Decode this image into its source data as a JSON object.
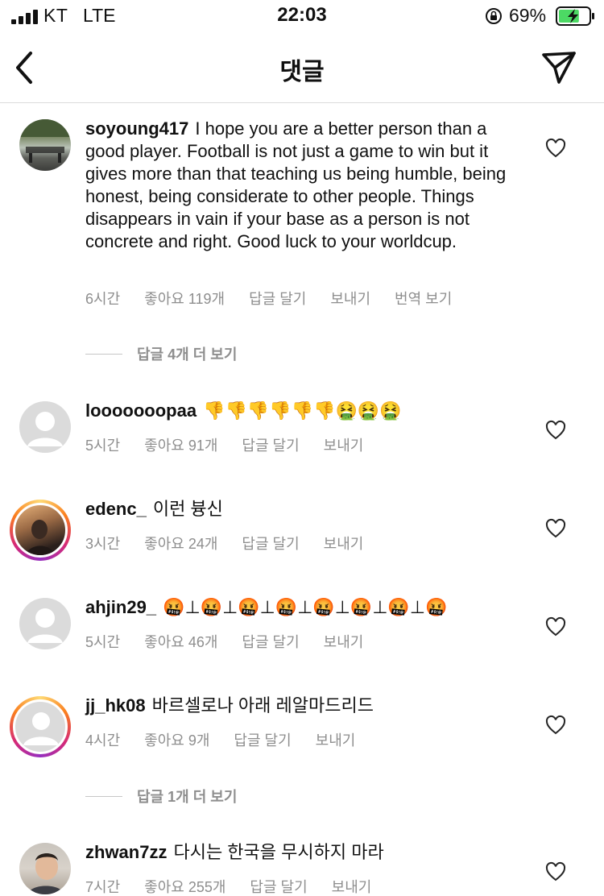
{
  "status_bar": {
    "carrier": "KT",
    "network": "LTE",
    "time": "22:03",
    "battery_percent": "69%",
    "battery_level": 0.69
  },
  "header": {
    "title": "댓글",
    "back_icon": "chevron-left-icon",
    "share_icon": "paper-plane-icon"
  },
  "comments": [
    {
      "username": "soyoung417",
      "text": "I hope you are a better person than a good player. Football is not just a game to win but it gives more than that teaching us being humble, being honest, being considerate to other people. Things disappears in vain if your base as a person is not concrete and right. Good luck to your worldcup.",
      "time": "6시간",
      "likes": "좋아요 119개",
      "reply": "답글 달기",
      "send": "보내기",
      "translate": "번역 보기",
      "view_replies": "답글 4개 더 보기"
    },
    {
      "username": "looooooopaa",
      "text": "👎👎👎👎👎👎🤮🤮🤮",
      "time": "5시간",
      "likes": "좋아요 91개",
      "reply": "답글 달기",
      "send": "보내기"
    },
    {
      "username": "edenc_",
      "text": "이런 븅신",
      "time": "3시간",
      "likes": "좋아요 24개",
      "reply": "답글 달기",
      "send": "보내기"
    },
    {
      "username": "ahjin29_",
      "text": "🤬⊥🤬⊥🤬⊥🤬⊥🤬⊥🤬⊥🤬⊥🤬",
      "time": "5시간",
      "likes": "좋아요 46개",
      "reply": "답글 달기",
      "send": "보내기"
    },
    {
      "username": "jj_hk08",
      "text": "바르셀로나 아래 레알마드리드",
      "time": "4시간",
      "likes": "좋아요 9개",
      "reply": "답글 달기",
      "send": "보내기",
      "view_replies": "답글 1개 더 보기"
    },
    {
      "username": "zhwan7zz",
      "text": "다시는 한국을 무시하지 마라",
      "time": "7시간",
      "likes": "좋아요 255개",
      "reply": "답글 달기",
      "send": "보내기"
    }
  ],
  "colors": {
    "meta_text": "#8e8e8e",
    "divider": "#dbdbdb",
    "story_ring": "#d62976"
  }
}
